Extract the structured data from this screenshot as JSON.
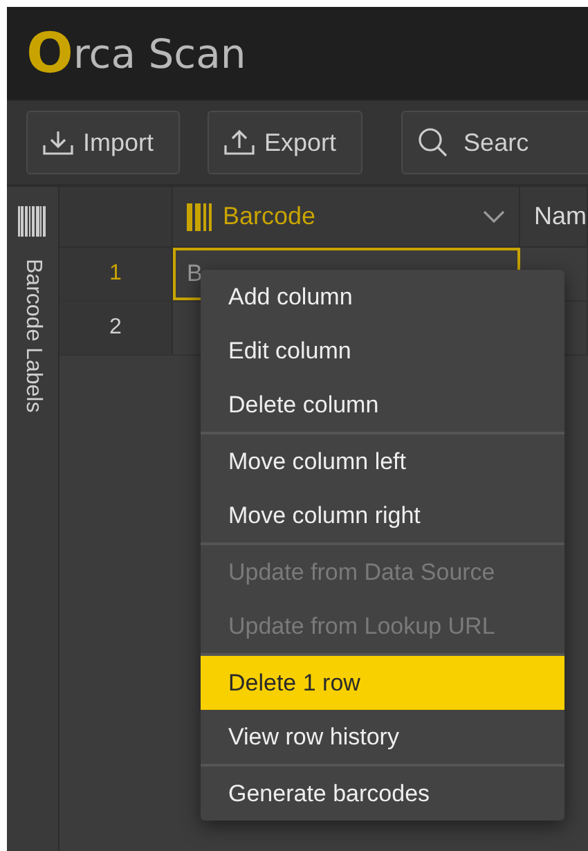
{
  "logo": {
    "initial": "O",
    "rest": "rca Scan"
  },
  "toolbar": {
    "buttons": [
      {
        "kind": "import",
        "label": "Import"
      },
      {
        "kind": "export",
        "label": "Export"
      }
    ],
    "search": {
      "placeholder": "Searc"
    }
  },
  "sidebar": {
    "label": "Barcode Labels"
  },
  "table": {
    "columns": [
      {
        "kind": "barcode",
        "label": "Barcode",
        "selected": true
      },
      {
        "kind": "text",
        "label": "Nam",
        "selected": false
      }
    ],
    "rows": [
      {
        "number": "1",
        "selected": true,
        "cells": [
          "B"
        ]
      },
      {
        "number": "2",
        "selected": false,
        "cells": [
          ""
        ]
      }
    ]
  },
  "context_menu": {
    "groups": [
      [
        {
          "label": "Add column",
          "disabled": false,
          "selected": false
        },
        {
          "label": "Edit column",
          "disabled": false,
          "selected": false
        },
        {
          "label": "Delete column",
          "disabled": false,
          "selected": false
        }
      ],
      [
        {
          "label": "Move column left",
          "disabled": false,
          "selected": false
        },
        {
          "label": "Move column right",
          "disabled": false,
          "selected": false
        }
      ],
      [
        {
          "label": "Update from Data Source",
          "disabled": true,
          "selected": false
        },
        {
          "label": "Update from Lookup URL",
          "disabled": true,
          "selected": false
        }
      ],
      [
        {
          "label": "Delete 1 row",
          "disabled": false,
          "selected": true
        },
        {
          "label": "View row history",
          "disabled": false,
          "selected": false
        }
      ],
      [
        {
          "label": "Generate barcodes",
          "disabled": false,
          "selected": false
        }
      ]
    ]
  }
}
